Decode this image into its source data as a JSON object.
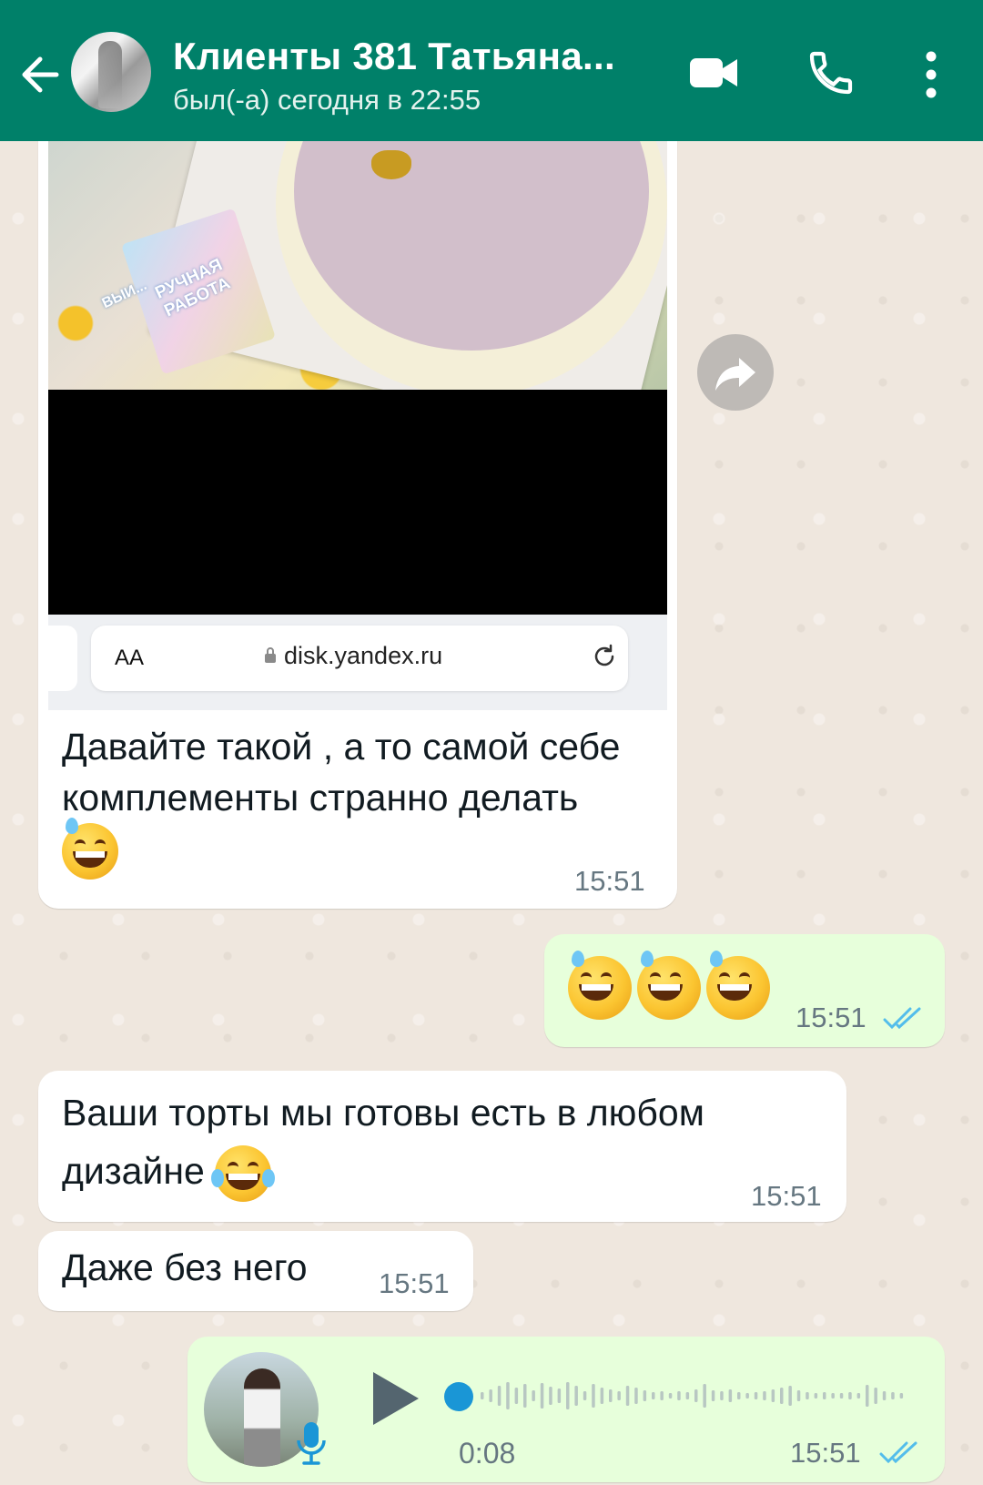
{
  "header": {
    "title": "Клиенты 381 Татьяна...",
    "status": "был(-а) сегодня в 22:55",
    "back_icon": "arrow-left-icon",
    "video_icon": "video-call-icon",
    "call_icon": "phone-icon",
    "menu_icon": "more-vert-icon",
    "color": "#008069"
  },
  "messages": [
    {
      "type": "image",
      "direction": "in",
      "image_labels": [
        "ВЫИ...",
        "РУЧНАЯ",
        "РАБОТА"
      ],
      "browser": {
        "aa": "AA",
        "url": "disk.yandex.ru"
      },
      "caption": "Давайте такой , а то самой себе комплементы странно делать",
      "emoji": "grinning-face-with-sweat",
      "time": "15:51"
    },
    {
      "type": "emoji",
      "direction": "out",
      "emojis": [
        "grinning-face-with-sweat",
        "grinning-face-with-sweat",
        "grinning-face-with-sweat"
      ],
      "time": "15:51",
      "status": "read"
    },
    {
      "type": "text",
      "direction": "in",
      "text": "Ваши торты мы готовы есть в любом дизайне",
      "emoji": "face-with-tears-of-joy",
      "time": "15:51"
    },
    {
      "type": "text",
      "direction": "in",
      "text": "Даже без него",
      "time": "15:51"
    },
    {
      "type": "voice",
      "direction": "out",
      "duration": "0:08",
      "progress": 0,
      "time": "15:51",
      "status": "read"
    }
  ],
  "colors": {
    "incoming_bubble": "#ffffff",
    "outgoing_bubble": "#e7ffdb",
    "read_ticks": "#53bdeb",
    "wallpaper": "#efe7de"
  }
}
